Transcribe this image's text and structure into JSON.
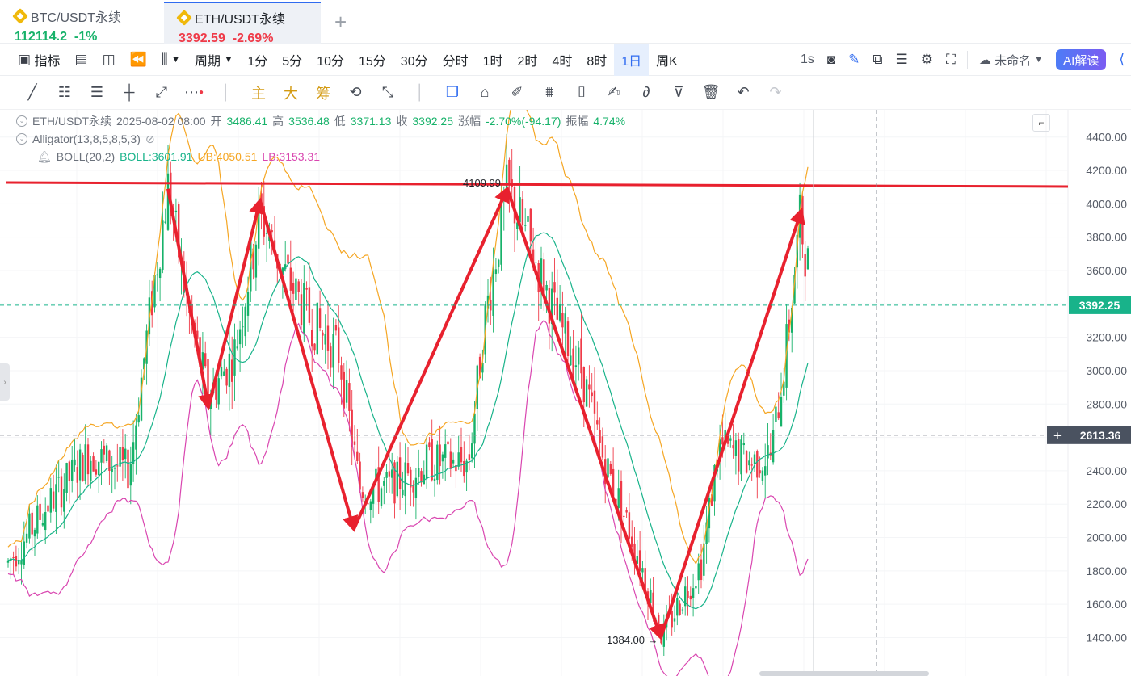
{
  "tabs": [
    {
      "symbol": "BTC/USDT永续",
      "price": "112114.2",
      "change": "-1%"
    },
    {
      "symbol": "ETH/USDT永续",
      "price": "3392.59",
      "change": "-2.69%"
    }
  ],
  "toolbar": {
    "indicators": "指标",
    "period": "周期",
    "intervals": [
      "1分",
      "5分",
      "10分",
      "15分",
      "30分",
      "分时",
      "1时",
      "2时",
      "4时",
      "8时",
      "1日",
      "周K"
    ],
    "active_interval": "1日",
    "refresh": "1s",
    "layout_name": "未命名",
    "ai_label": "AI解读"
  },
  "drawbar": {
    "main": "主",
    "big": "大",
    "chips": "筹"
  },
  "legend": {
    "symbol": "ETH/USDT永续",
    "datetime": "2025-08-02 08:00",
    "open_label": "开",
    "open": "3486.41",
    "high_label": "高",
    "high": "3536.48",
    "low_label": "低",
    "low": "3371.13",
    "close_label": "收",
    "close": "3392.25",
    "change_label": "涨幅",
    "change": "-2.70%(-94.17)",
    "amp_label": "振幅",
    "amp": "4.74%",
    "alligator": "Alligator(13,8,5,8,5,3)",
    "boll": "BOLL(20,2)",
    "boll_mid": "BOLL:3601.91",
    "boll_ub": "UB:4050.51",
    "boll_lb": "LB:3153.31"
  },
  "annotations": {
    "high_mark": "4109.99",
    "low_mark": "1384.00"
  },
  "price_axis": {
    "ticks": [
      "4400.00",
      "4200.00",
      "4000.00",
      "3800.00",
      "3600.00",
      "3400.00",
      "3200.00",
      "3000.00",
      "2800.00",
      "2600.00",
      "2400.00",
      "2200.00",
      "2000.00",
      "1800.00",
      "1600.00",
      "1400.00"
    ],
    "last_price": "3392.25",
    "crosshair_price": "2613.36"
  },
  "colors": {
    "up": "#17b26a",
    "down": "#ef3a48",
    "accent": "#2f6bf0",
    "resistance": "#e8212e",
    "boll_ub": "#f5a623",
    "boll_lb": "#d946b0",
    "boll_mid": "#18b38a"
  },
  "chart_data": {
    "type": "candlestick",
    "ylim": [
      1300,
      4500
    ],
    "resistance_level": 4100,
    "zigzag": [
      {
        "label": "peak",
        "price": 4090
      },
      {
        "label": "trough",
        "price": 2780
      },
      {
        "label": "peak",
        "price": 4020
      },
      {
        "label": "trough",
        "price": 2050
      },
      {
        "label": "peak",
        "price": 4090
      },
      {
        "label": "trough",
        "price": 1400
      },
      {
        "label": "peak",
        "price": 3960
      }
    ]
  }
}
